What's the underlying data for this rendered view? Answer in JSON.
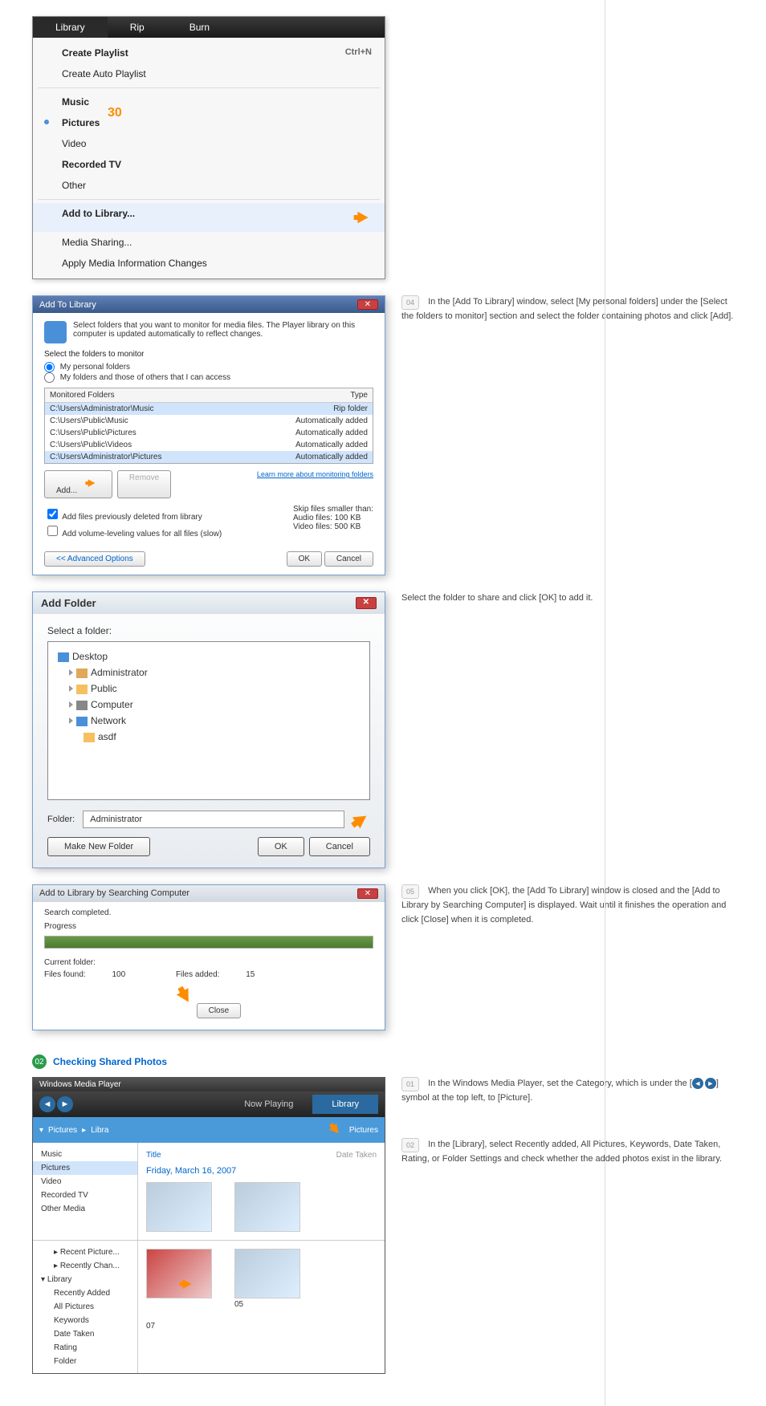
{
  "library_menu": {
    "tabs": {
      "library": "Library",
      "rip": "Rip",
      "burn": "Burn"
    },
    "create_playlist": "Create Playlist",
    "create_playlist_shortcut": "Ctrl+N",
    "create_auto_playlist": "Create Auto Playlist",
    "music": "Music",
    "pictures": "Pictures",
    "video": "Video",
    "recorded_tv": "Recorded TV",
    "other": "Other",
    "add_to_library": "Add to Library...",
    "media_sharing": "Media Sharing...",
    "apply_changes": "Apply Media Information Changes"
  },
  "badge_30": "30",
  "add_lib_dialog": {
    "title": "Add To Library",
    "msg": "Select folders that you want to monitor for media files. The Player library on this computer is updated automatically to reflect changes.",
    "select_label": "Select the folders to monitor",
    "radio1": "My personal folders",
    "radio2": "My folders and those of others that I can access",
    "col_monitored": "Monitored Folders",
    "col_type": "Type",
    "rows": [
      {
        "path": "C:\\Users\\Administrator\\Music",
        "type": "Rip folder"
      },
      {
        "path": "C:\\Users\\Public\\Music",
        "type": "Automatically added"
      },
      {
        "path": "C:\\Users\\Public\\Pictures",
        "type": "Automatically added"
      },
      {
        "path": "C:\\Users\\Public\\Videos",
        "type": "Automatically added"
      },
      {
        "path": "C:\\Users\\Administrator\\Pictures",
        "type": "Automatically added"
      }
    ],
    "add_btn": "Add...",
    "remove_btn": "Remove",
    "learn_more": "Learn more about monitoring folders",
    "chk_add_prev": "Add files previously deleted from library",
    "chk_volume": "Add volume-leveling values for all files (slow)",
    "skip_label": "Skip files smaller than:",
    "audio_files": "Audio files:",
    "audio_val": "100",
    "video_files": "Video files:",
    "video_val": "500",
    "kb": "KB",
    "adv_opt": "<< Advanced Options",
    "ok": "OK",
    "cancel": "Cancel"
  },
  "step04": {
    "num": "04",
    "text": "In the [Add To Library] window, select [My personal folders] under the [Select the folders to monitor] section and select the folder containing photos and click [Add]."
  },
  "add_folder": {
    "title": "Add Folder",
    "select_label": "Select a folder:",
    "desktop": "Desktop",
    "administrator": "Administrator",
    "public": "Public",
    "computer": "Computer",
    "network": "Network",
    "asdf": "asdf",
    "folder_label": "Folder:",
    "folder_value": "Administrator",
    "make_new": "Make New Folder",
    "ok": "OK",
    "cancel": "Cancel"
  },
  "step_select": {
    "text": "Select the folder to share and click [OK] to add it."
  },
  "search_dlg": {
    "title": "Add to Library by Searching Computer",
    "completed": "Search completed.",
    "progress": "Progress",
    "current_folder": "Current folder:",
    "files_found": "Files found:",
    "files_found_val": "100",
    "files_added": "Files added:",
    "files_added_val": "15",
    "close": "Close"
  },
  "step05": {
    "num": "05",
    "text": "When you click [OK], the [Add To Library] window is closed and the [Add to Library by Searching Computer] is displayed. Wait until it finishes the operation and click [Close] when it is completed."
  },
  "section": {
    "num": "02",
    "title": "Checking Shared Photos"
  },
  "wmp": {
    "title": "Windows Media Player",
    "tab_now_playing": "Now Playing",
    "tab_library": "Library",
    "crumb_pictures": "Pictures",
    "crumb_libra": "Libra",
    "dropdown_pictures": "Pictures",
    "cat_music": "Music",
    "cat_pictures": "Pictures",
    "cat_video": "Video",
    "cat_recorded": "Recorded TV",
    "cat_other": "Other Media",
    "col_title": "Title",
    "col_date": "Date Taken",
    "date_header": "Friday, March 16, 2007",
    "side_recent_pic": "Recent Picture...",
    "side_recent_chan": "Recently Chan...",
    "side_library": "Library",
    "side_recent_add": "Recently Added",
    "side_all_pic": "All Pictures",
    "side_keywords": "Keywords",
    "side_date": "Date Taken",
    "side_rating": "Rating",
    "side_folder": "Folder",
    "thumb1": "07",
    "thumb2": "05"
  },
  "step01": {
    "num": "01",
    "text_a": "In the Windows Media Player, set the Category, which is under the [",
    "text_b": "] symbol at the top left, to [Picture]."
  },
  "step02": {
    "num": "02",
    "text": "In the [Library], select Recently added, All Pictures, Keywords, Date Taken, Rating, or Folder Settings and check whether the added photos exist in the library."
  }
}
